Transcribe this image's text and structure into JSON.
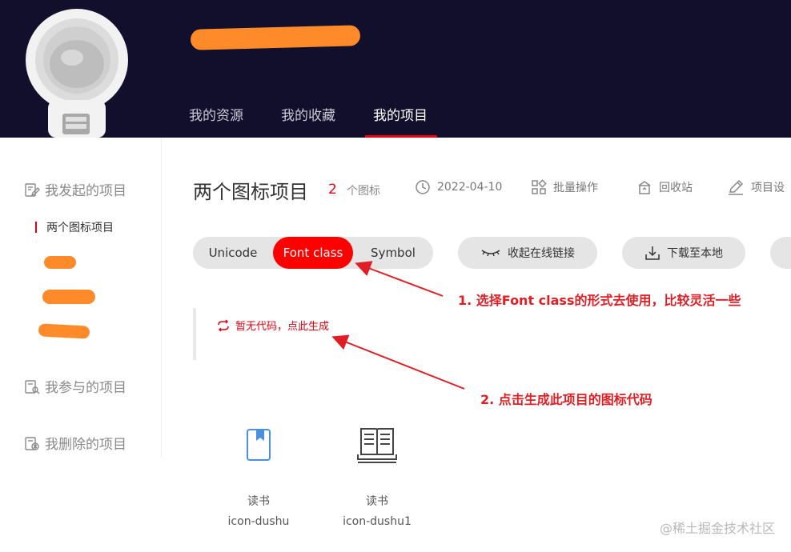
{
  "header": {
    "nav": [
      {
        "label": "我的资源",
        "active": false
      },
      {
        "label": "我的收藏",
        "active": false
      },
      {
        "label": "我的项目",
        "active": true
      }
    ]
  },
  "sidebar": {
    "initiated": "我发起的项目",
    "active_project": "两个图标项目",
    "participated": "我参与的项目",
    "deleted": "我删除的项目"
  },
  "project": {
    "title": "两个图标项目",
    "icon_count": "2",
    "icon_count_label": "个图标",
    "date": "2022-04-10",
    "batch": "批量操作",
    "recycle": "回收站",
    "settings": "项目设"
  },
  "tabs": {
    "unicode": "Unicode",
    "font_class": "Font class",
    "symbol": "Symbol",
    "active": "Font class"
  },
  "actions": {
    "collapse_link": "收起在线链接",
    "download": "下载至本地"
  },
  "code_area": {
    "generate": "暂无代码，点此生成"
  },
  "icons": [
    {
      "name": "读书",
      "code": "icon-dushu",
      "glyph": "bookmark-book-icon"
    },
    {
      "name": "读书",
      "code": "icon-dushu1",
      "glyph": "open-book-icon"
    }
  ],
  "annotations": {
    "step1": "1. 选择Font class的形式去使用，比较灵活一些",
    "step2": "2. 点击生成此项目的图标代码"
  },
  "watermark": "@稀土掘金技术社区",
  "colors": {
    "header_bg": "#110f2c",
    "accent": "#e60012",
    "active_tab": "#ff0000",
    "annotation": "#e01e24",
    "redaction": "#ff8a2a"
  }
}
